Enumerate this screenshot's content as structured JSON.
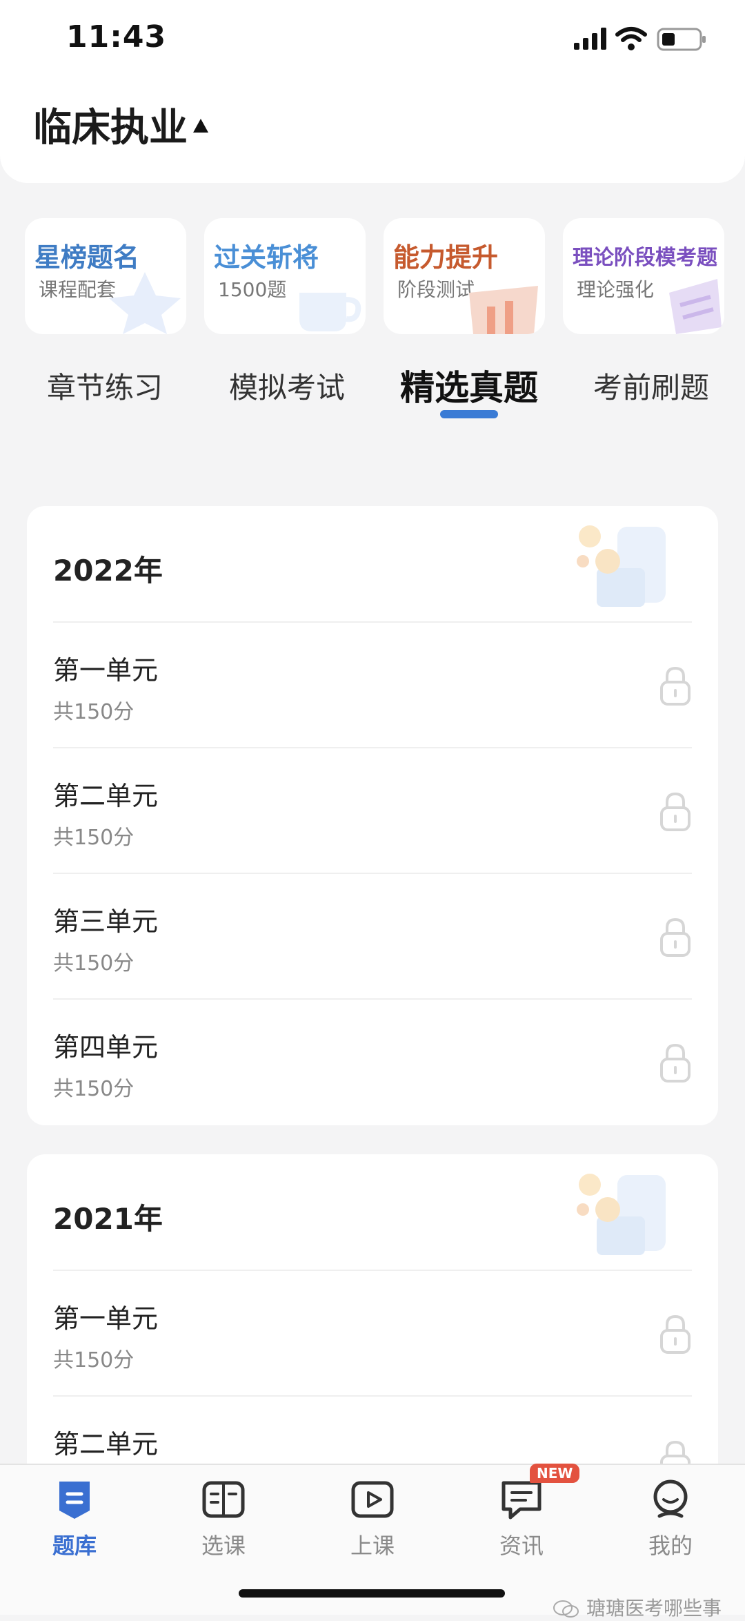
{
  "status_bar": {
    "time": "11:43"
  },
  "header": {
    "exam_title": "临床执业"
  },
  "cards": [
    {
      "title": "星榜题名",
      "subtitle": "课程配套",
      "color": "#3f7cc4"
    },
    {
      "title": "过关斩将",
      "subtitle": "1500题",
      "color": "#4a8fd6"
    },
    {
      "title": "能力提升",
      "subtitle": "阶段测试",
      "color": "#c65a2e"
    },
    {
      "title": "理论阶段模考题",
      "subtitle": "理论强化",
      "color": "#7a4fbf"
    }
  ],
  "tabs": [
    {
      "label": "章节练习"
    },
    {
      "label": "模拟考试"
    },
    {
      "label": "精选真题",
      "active": true
    },
    {
      "label": "考前刷题"
    }
  ],
  "sections": [
    {
      "year": "2022年",
      "units": [
        {
          "name": "第一单元",
          "score": "共150分"
        },
        {
          "name": "第二单元",
          "score": "共150分"
        },
        {
          "name": "第三单元",
          "score": "共150分"
        },
        {
          "name": "第四单元",
          "score": "共150分"
        }
      ]
    },
    {
      "year": "2021年",
      "units": [
        {
          "name": "第一单元",
          "score": "共150分"
        },
        {
          "name": "第二单元",
          "score": ""
        }
      ]
    }
  ],
  "bottom_nav": [
    {
      "label": "题库",
      "icon": "question-bank-icon",
      "active": true
    },
    {
      "label": "选课",
      "icon": "course-select-icon"
    },
    {
      "label": "上课",
      "icon": "play-class-icon"
    },
    {
      "label": "资讯",
      "icon": "news-icon",
      "badge": "NEW"
    },
    {
      "label": "我的",
      "icon": "profile-icon"
    }
  ],
  "watermark": "瑭瑭医考哪些事",
  "colors": {
    "accent": "#3a7bd5",
    "badge": "#e3523f"
  }
}
